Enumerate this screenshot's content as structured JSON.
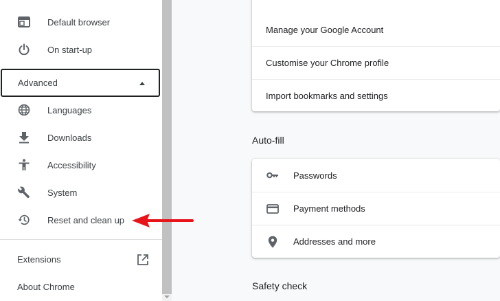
{
  "sidebar": {
    "items_top": [
      {
        "label": "Default browser",
        "icon": "browser-window-icon"
      },
      {
        "label": "On start-up",
        "icon": "power-icon"
      }
    ],
    "advanced_label": "Advanced",
    "items_advanced": [
      {
        "label": "Languages",
        "icon": "globe-icon"
      },
      {
        "label": "Downloads",
        "icon": "download-icon"
      },
      {
        "label": "Accessibility",
        "icon": "accessibility-icon"
      },
      {
        "label": "System",
        "icon": "wrench-icon"
      },
      {
        "label": "Reset and clean up",
        "icon": "history-icon"
      }
    ],
    "extensions_label": "Extensions",
    "about_label": "About Chrome"
  },
  "main": {
    "people_rows": [
      "Manage your Google Account",
      "Customise your Chrome profile",
      "Import bookmarks and settings"
    ],
    "autofill_title": "Auto-fill",
    "autofill_rows": [
      {
        "label": "Passwords",
        "icon": "key-icon"
      },
      {
        "label": "Payment methods",
        "icon": "credit-card-icon"
      },
      {
        "label": "Addresses and more",
        "icon": "location-pin-icon"
      }
    ],
    "safety_title": "Safety check"
  },
  "colors": {
    "annotation_arrow": "#e8141b",
    "icon": "#5f6368"
  }
}
